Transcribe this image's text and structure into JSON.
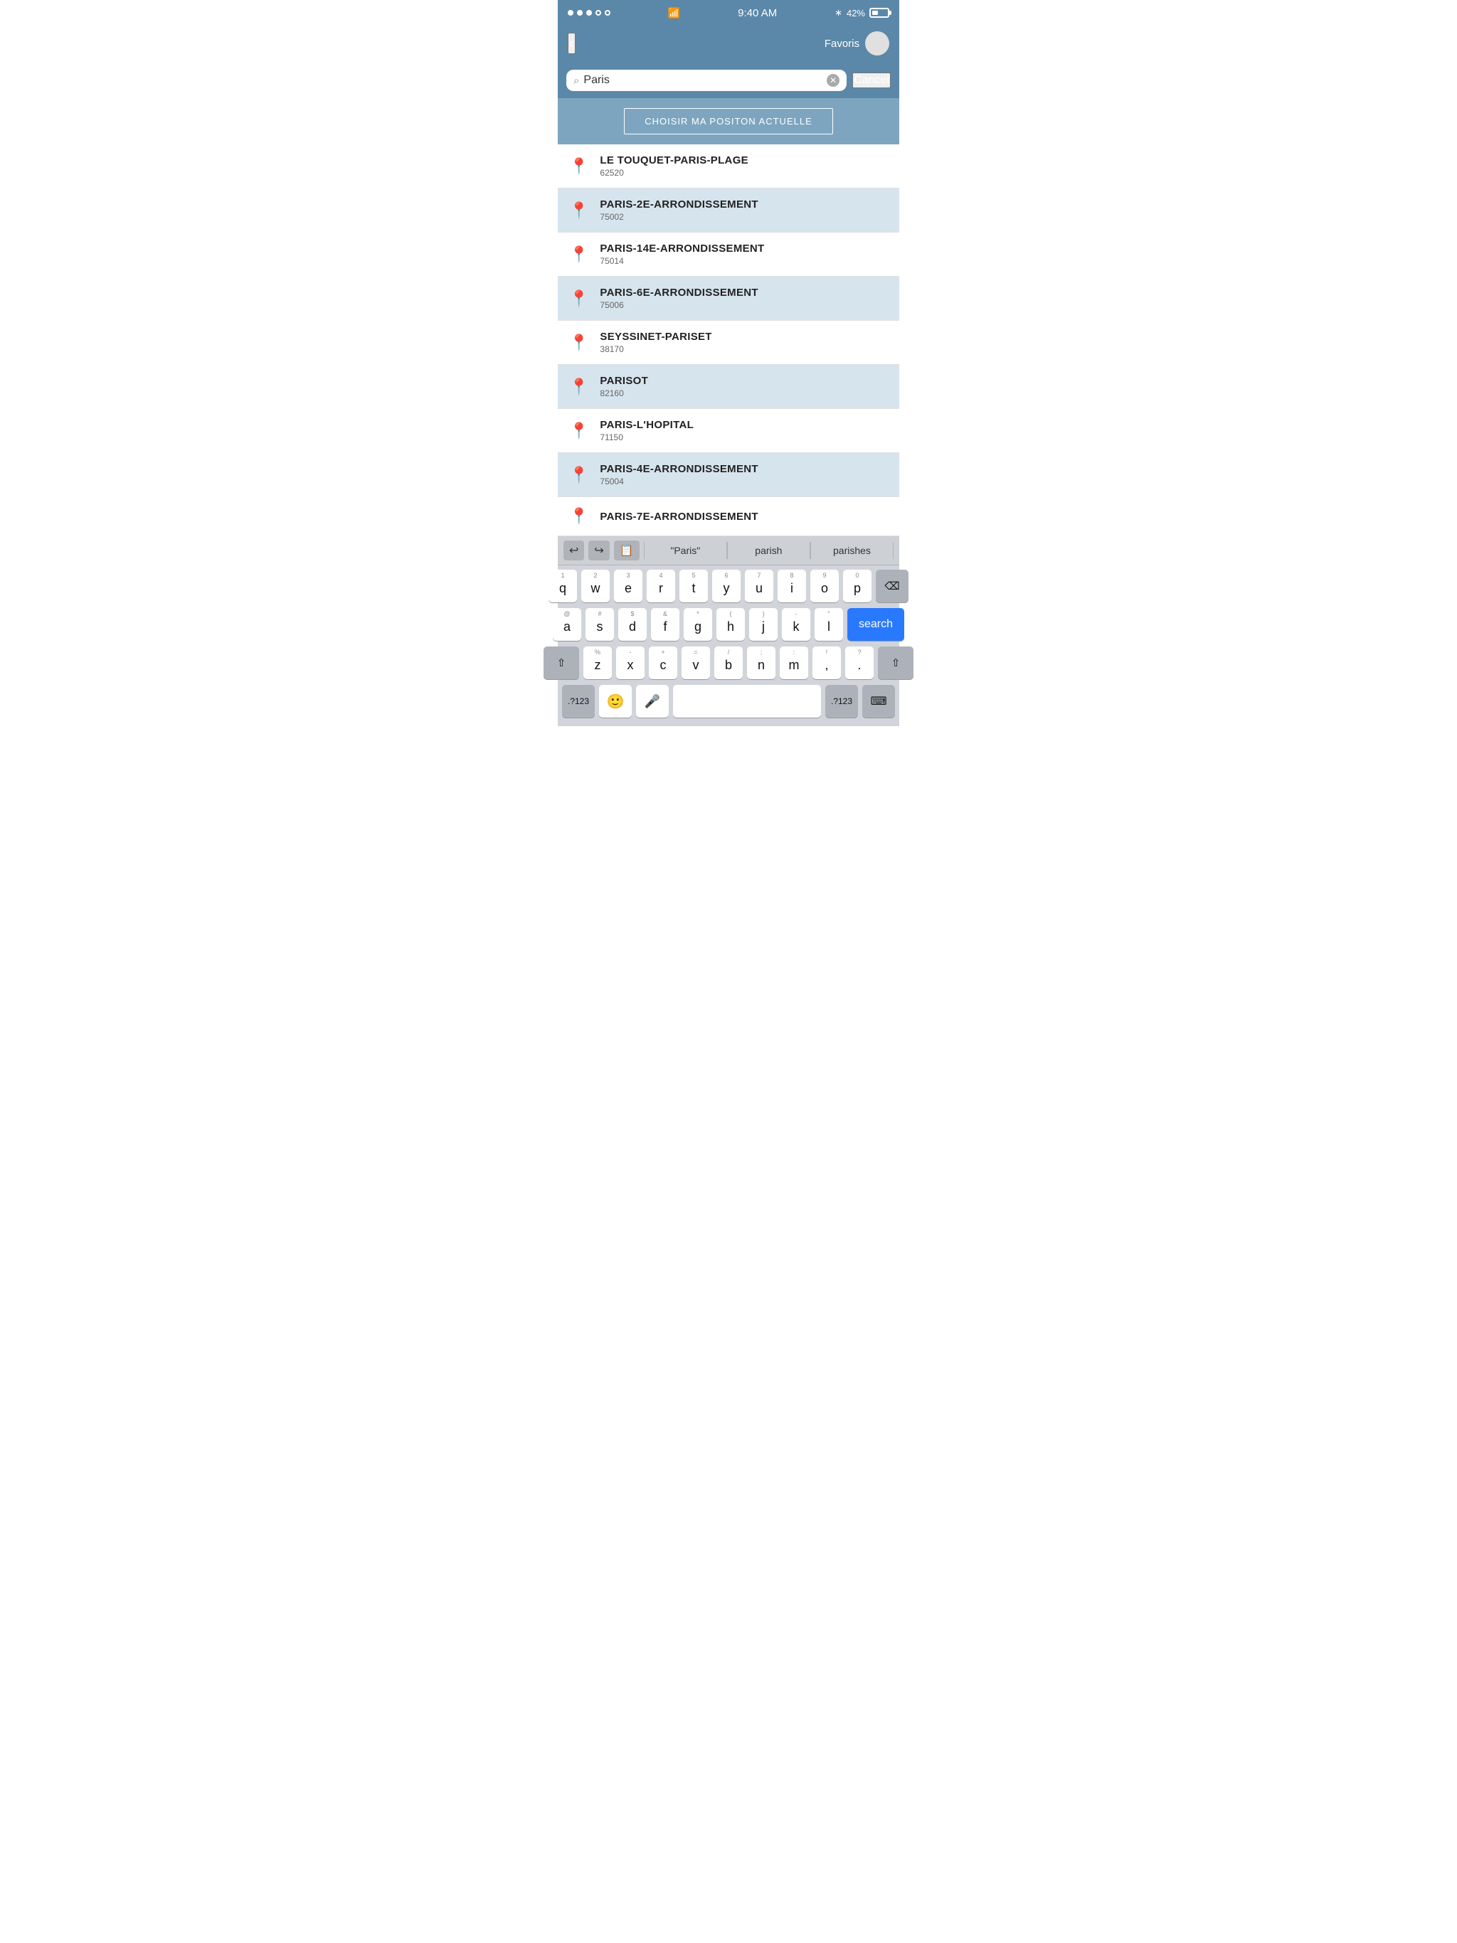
{
  "statusBar": {
    "time": "9:40 AM",
    "battery": "42%",
    "wifi": true
  },
  "navBar": {
    "backLabel": "‹",
    "favorisLabel": "Favoris"
  },
  "searchBar": {
    "value": "Paris",
    "cancelLabel": "Cancel"
  },
  "positionButton": {
    "label": "CHOISIR  MA POSITON ACTUELLE"
  },
  "results": [
    {
      "name": "LE TOUQUET-PARIS-PLAGE",
      "code": "62520",
      "alt": false
    },
    {
      "name": "PARIS-2E-ARRONDISSEMENT",
      "code": "75002",
      "alt": true
    },
    {
      "name": "PARIS-14E-ARRONDISSEMENT",
      "code": "75014",
      "alt": false
    },
    {
      "name": "PARIS-6E-ARRONDISSEMENT",
      "code": "75006",
      "alt": true
    },
    {
      "name": "SEYSSINET-PARISET",
      "code": "38170",
      "alt": false
    },
    {
      "name": "PARISOT",
      "code": "82160",
      "alt": true
    },
    {
      "name": "PARIS-L'HOPITAL",
      "code": "71150",
      "alt": false
    },
    {
      "name": "PARIS-4E-ARRONDISSEMENT",
      "code": "75004",
      "alt": true
    },
    {
      "name": "PARIS-7E-ARRONDISSEMENT",
      "code": "",
      "alt": false
    }
  ],
  "keyboard": {
    "suggestions": [
      "\"Paris\"",
      "parish",
      "parishes"
    ],
    "rows": [
      [
        "q",
        "w",
        "e",
        "r",
        "t",
        "y",
        "u",
        "i",
        "o",
        "p"
      ],
      [
        "a",
        "s",
        "d",
        "f",
        "g",
        "h",
        "j",
        "k",
        "l"
      ],
      [
        "z",
        "x",
        "c",
        "v",
        "b",
        "n",
        "m"
      ]
    ],
    "nums": [
      "1",
      "2",
      "3",
      "4",
      "5",
      "6",
      "7",
      "8",
      "9",
      "0"
    ],
    "searchLabel": "search",
    "spaceLabel": ""
  }
}
